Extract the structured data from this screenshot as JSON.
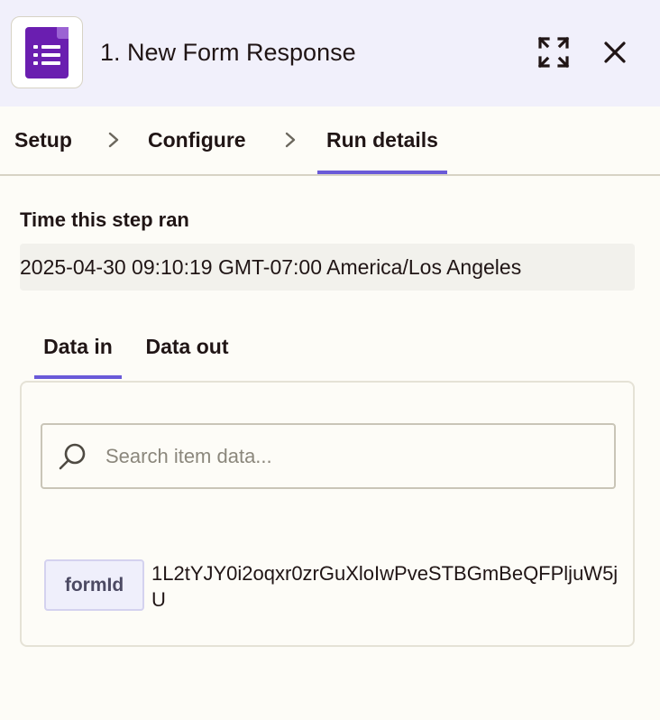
{
  "header": {
    "app_icon": "google-forms-icon",
    "title": "1. New Form Response",
    "expand_icon": "expand-icon",
    "close_icon": "close-icon"
  },
  "steps": {
    "items": [
      {
        "label": "Setup"
      },
      {
        "label": "Configure"
      },
      {
        "label": "Run details",
        "active": true
      }
    ]
  },
  "run": {
    "time_label": "Time this step ran",
    "time_value": "2025-04-30 09:10:19 GMT-07:00 America/Los Angeles"
  },
  "data_tabs": {
    "items": [
      {
        "label": "Data in",
        "active": true
      },
      {
        "label": "Data out"
      }
    ]
  },
  "search": {
    "placeholder": "Search item data...",
    "value": ""
  },
  "fields": [
    {
      "key": "formId",
      "value": "1L2tYJY0i2oqxr0zrGuXloIwPveSTBGmBeQFPljuW5jU"
    }
  ],
  "colors": {
    "header_bg": "#f1f0fb",
    "accent": "#6a5ad8",
    "forms_purple": "#6a1eb0",
    "page_bg": "#fdfcf7"
  }
}
